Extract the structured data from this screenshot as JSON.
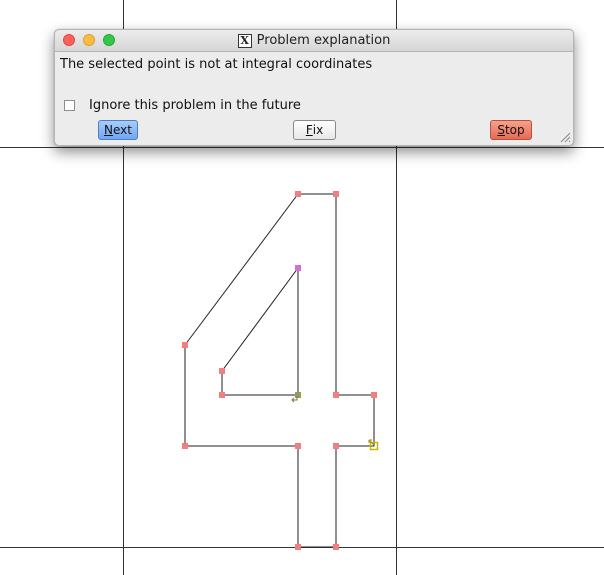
{
  "dialog": {
    "title": "Problem explanation",
    "title_icon": "x-window-icon",
    "message": "The selected point is not at integral coordinates",
    "ignore_checkbox": {
      "label": "Ignore this problem in the future",
      "checked": false
    },
    "buttons": {
      "next": {
        "mnemonic": "N",
        "rest": "ext"
      },
      "fix": {
        "mnemonic": "F",
        "rest": "ix"
      },
      "stop": {
        "mnemonic": "S",
        "rest": "top"
      }
    }
  },
  "glyph": {
    "character": "4",
    "point_color": "#f08080",
    "selected_point_color": "#e0e000"
  },
  "colors": {
    "next_button": "#7fb2f5",
    "stop_button": "#ee7a63",
    "close_light": "#fc615d",
    "min_light": "#fdbc40",
    "max_light": "#34c84a"
  }
}
